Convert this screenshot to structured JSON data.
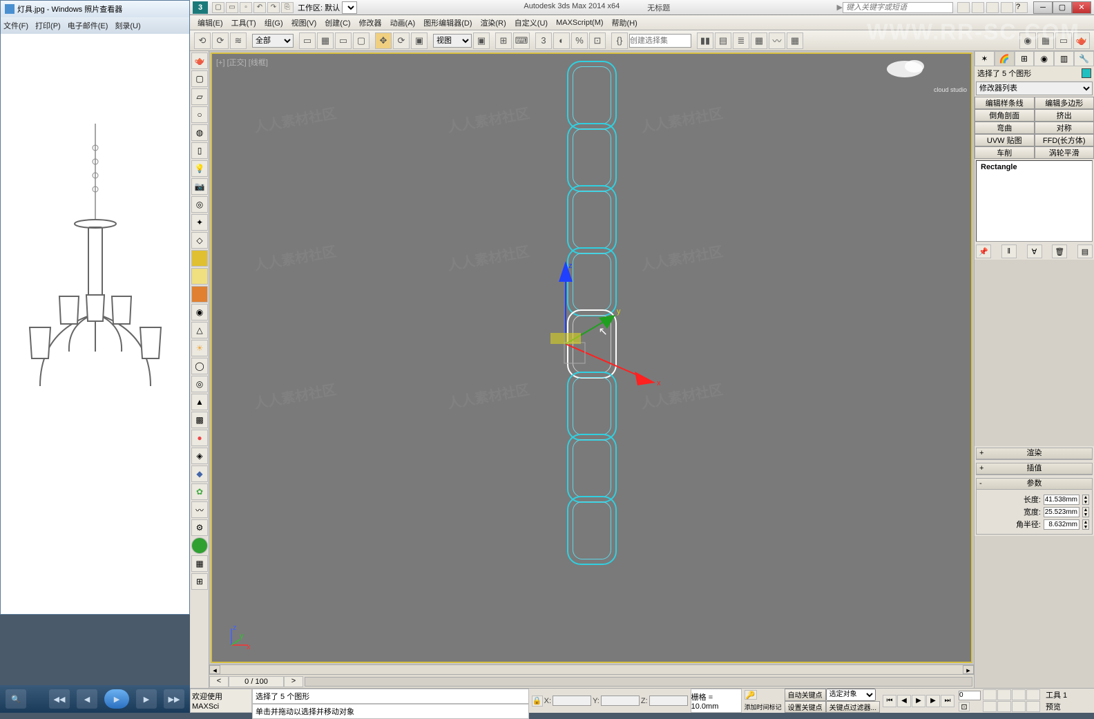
{
  "photoviewer": {
    "title": "灯具.jpg - Windows 照片查看器",
    "menus": [
      "文件(F)",
      "打印(P)",
      "电子邮件(E)",
      "刻录(U)"
    ]
  },
  "max": {
    "title_center": "Autodesk 3ds Max  2014 x64",
    "title_file": "无标题",
    "workspace_label": "工作区: 默认",
    "search_placeholder": "键入关键字或短语",
    "menus": [
      "编辑(E)",
      "工具(T)",
      "组(G)",
      "视图(V)",
      "创建(C)",
      "修改器",
      "动画(A)",
      "图形编辑器(D)",
      "渲染(R)",
      "自定义(U)",
      "MAXScript(M)",
      "帮助(H)"
    ],
    "filter_all": "全部",
    "viewlabel_dd": "视图",
    "selectionset": "创建选择集",
    "viewport_label": "[+] [正交] [线框]",
    "timeslider_val": "0 / 100",
    "cmdpanel": {
      "selection_text": "选择了 5 个图形",
      "modifier_list": "修改器列表",
      "mod_btns": [
        [
          "编辑样条线",
          "编辑多边形"
        ],
        [
          "倒角剖面",
          "挤出"
        ],
        [
          "弯曲",
          "对称"
        ],
        [
          "UVW 贴图",
          "FFD(长方体)"
        ],
        [
          "车削",
          "涡轮平滑"
        ]
      ],
      "stack_item": "Rectangle",
      "rollouts": [
        "渲染",
        "插值",
        "参数"
      ],
      "params": {
        "length_label": "长度:",
        "length_val": "41.538mm",
        "width_label": "宽度:",
        "width_val": "25.523mm",
        "corner_label": "角半径:",
        "corner_val": "8.632mm"
      }
    },
    "status": {
      "script1": "欢迎使用",
      "script2": "MAXSci",
      "prompt1": "选择了 5 个图形",
      "prompt2": "单击并拖动以选择并移动对象",
      "x": "X:",
      "y": "Y:",
      "z": "Z:",
      "grid": "栅格 = 10.0mm",
      "add_time": "添加时间标记",
      "autokey": "自动关键点",
      "setkey": "设置关键点",
      "selobj": "选定对象",
      "keyfilter": "关键点过滤器...",
      "nav1": "工具 1",
      "nav2": "预览"
    }
  },
  "url_watermark": "WWW.RR-SC.COM",
  "cloud_text": "cloud studio"
}
